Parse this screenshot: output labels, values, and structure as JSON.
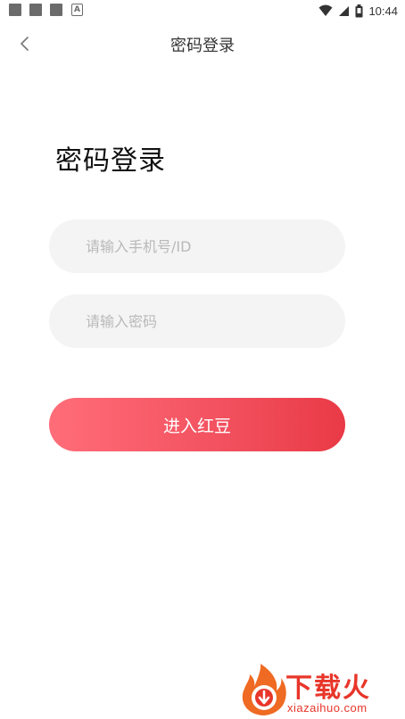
{
  "status_bar": {
    "time": "10:44",
    "notification_icons": [
      "app-icon",
      "app-icon",
      "app-icon",
      "a-icon"
    ],
    "system_icons": [
      "wifi-icon",
      "signal-icon",
      "battery-icon"
    ]
  },
  "header": {
    "back_icon": "chevron-left-icon",
    "title": "密码登录"
  },
  "main": {
    "heading": "密码登录",
    "phone_input": {
      "value": "",
      "placeholder": "请输入手机号/ID"
    },
    "password_input": {
      "value": "",
      "placeholder": "请输入密码"
    },
    "submit_label": "进入红豆"
  },
  "watermark": {
    "text": "下载火",
    "url": "xiazaihuo.com"
  },
  "colors": {
    "accent_start": "#ff6d78",
    "accent_end": "#e93a46",
    "input_bg": "#f4f4f4",
    "watermark": "#e8362a"
  }
}
